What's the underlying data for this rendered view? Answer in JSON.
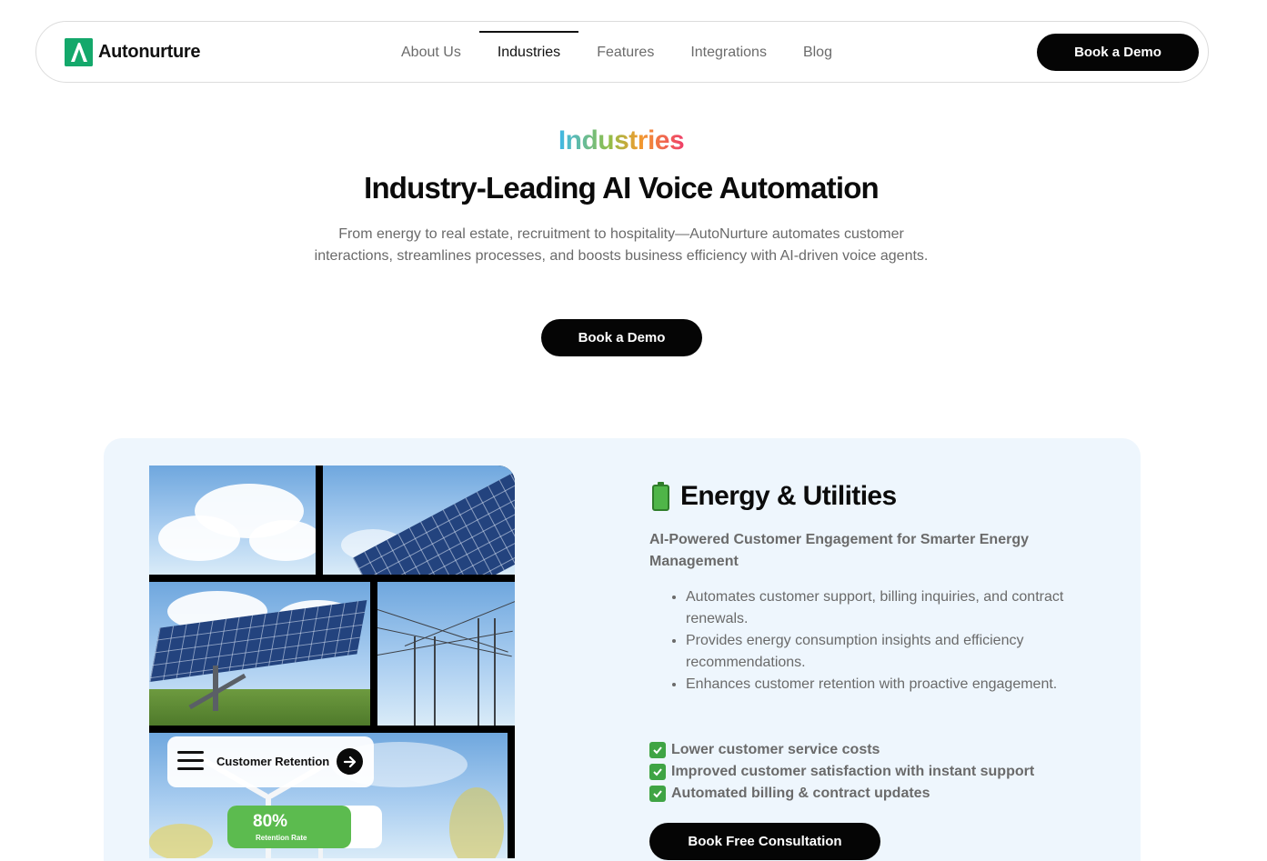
{
  "header": {
    "brand": "Autonurture",
    "nav": [
      "About Us",
      "Industries",
      "Features",
      "Integrations",
      "Blog"
    ],
    "active_nav": "Industries",
    "cta": "Book a Demo"
  },
  "hero": {
    "eyebrow": "Industries",
    "title": "Industry-Leading AI Voice Automation",
    "subtitle": "From energy to real estate, recruitment to hospitality—AutoNurture automates customer interactions, streamlines processes, and boosts business efficiency with AI-driven voice agents.",
    "cta": "Book a Demo"
  },
  "industry": {
    "icon": "battery-icon",
    "title": "Energy & Utilities",
    "subtitle": "AI-Powered Customer Engagement for Smarter Energy Management",
    "bullets": [
      "Automates customer support, billing inquiries, and contract renewals.",
      "Provides energy consumption insights and efficiency recommendations.",
      "Enhances customer retention with proactive engagement."
    ],
    "benefits": [
      "Lower customer service costs",
      "Improved customer satisfaction with instant support",
      "Automated billing & contract updates"
    ],
    "cta": "Book Free Consultation",
    "collage": {
      "chip_label": "Customer Retention",
      "stat_value": "80%",
      "stat_fraction": 0.8,
      "stat_label": "Retention Rate"
    }
  },
  "colors": {
    "brand_green": "#14a86b",
    "card_bg": "#eef6fd",
    "button_black": "#050505",
    "stat_green": "#5cbb4f"
  }
}
